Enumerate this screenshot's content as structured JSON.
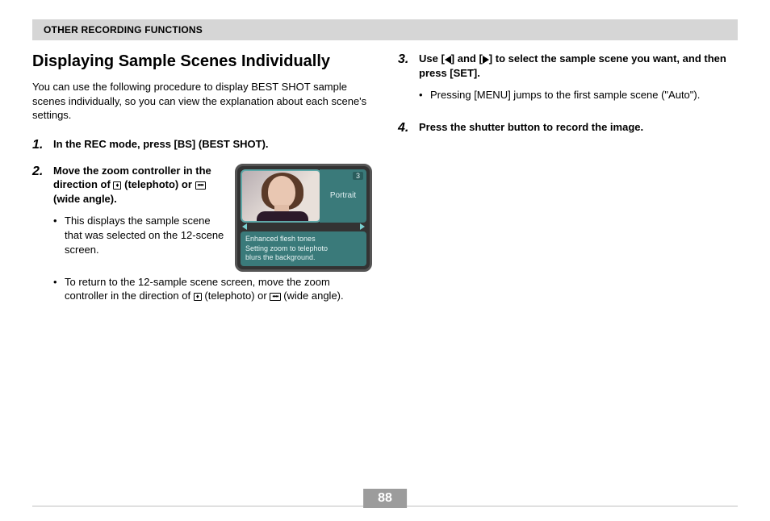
{
  "header": {
    "title": "OTHER RECORDING FUNCTIONS"
  },
  "section_title": "Displaying Sample Scenes Individually",
  "intro": "You can use the following procedure to display BEST SHOT sample scenes individually, so you can view the explanation about each scene's settings.",
  "step1": {
    "num": "1.",
    "title": "In the REC mode, press [BS] (BEST SHOT)."
  },
  "step2": {
    "num": "2.",
    "title_pre": "Move the zoom controller in the direction of ",
    "title_mid": " (telephoto) or ",
    "title_post": " (wide angle).",
    "bullet1": "This displays the sample scene that was selected on the 12-scene screen.",
    "bullet2_pre": "To return to the 12-sample scene screen, move the zoom controller in the direction of ",
    "bullet2_mid": " (telephoto) or ",
    "bullet2_post": " (wide angle)."
  },
  "step3": {
    "num": "3.",
    "title_pre": "Use [",
    "title_mid": "] and [",
    "title_post": "] to select the sample scene you want, and then press [SET].",
    "bullet1": "Pressing [MENU] jumps to the first sample scene (\"Auto\")."
  },
  "step4": {
    "num": "4.",
    "title": "Press the shutter button to record the image."
  },
  "sample": {
    "index": "3",
    "label": "Portrait",
    "desc_l1": "Enhanced flesh tones",
    "desc_l2": "Setting zoom to telephoto",
    "desc_l3": "blurs the background."
  },
  "icons": {
    "tele_glyph": "♦",
    "wide_glyph": "••••"
  },
  "page_number": "88"
}
